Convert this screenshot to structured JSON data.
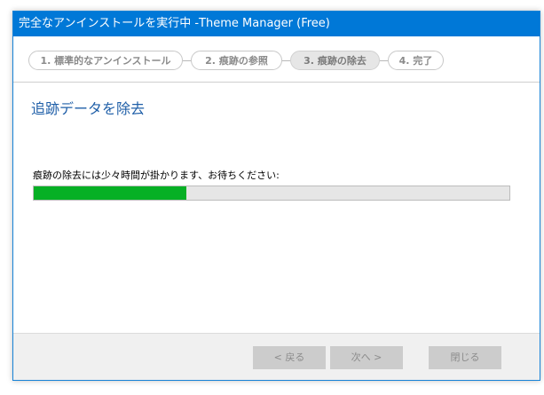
{
  "window": {
    "title": "完全なアンインストールを実行中 -Theme Manager (Free)"
  },
  "steps": [
    {
      "label": "1. 標準的なアンインストール",
      "active": false
    },
    {
      "label": "2. 痕跡の参照",
      "active": false
    },
    {
      "label": "3. 痕跡の除去",
      "active": true
    },
    {
      "label": "4. 完了",
      "active": false
    }
  ],
  "content": {
    "heading": "追跡データを除去",
    "message": "痕跡の除去には少々時間が掛かります、お待ちください:",
    "progress_fraction": 0.32
  },
  "buttons": {
    "back": "< 戻る",
    "next": "次へ >",
    "close": "閉じる"
  },
  "colors": {
    "titlebar": "#0078d7",
    "heading": "#1f5fa8",
    "progress_fill": "#06b025"
  }
}
